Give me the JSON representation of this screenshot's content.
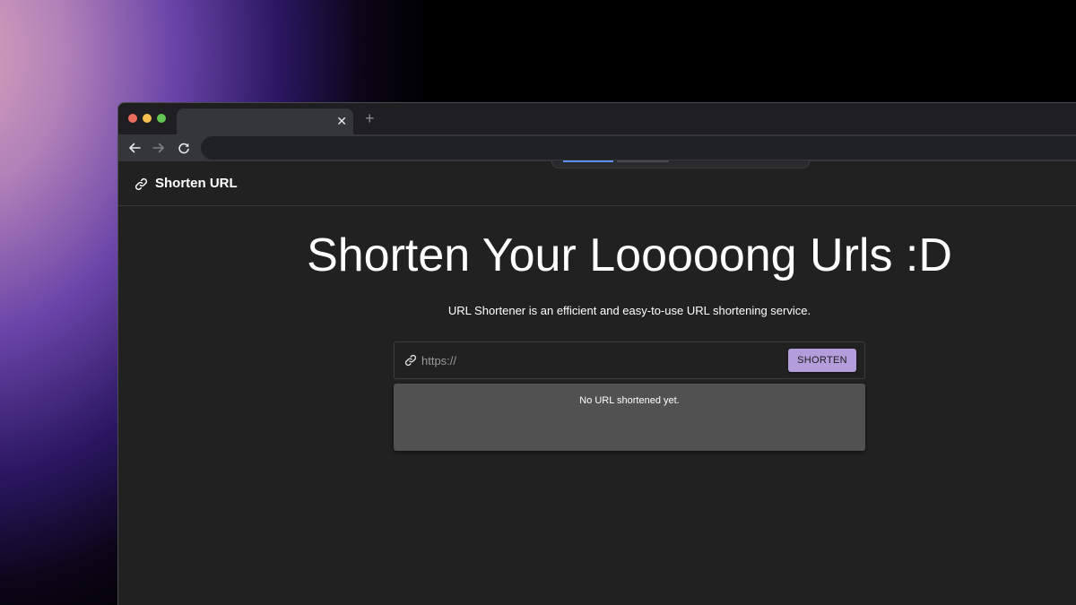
{
  "browser": {
    "tab_close": "✕",
    "new_tab": "+"
  },
  "header": {
    "brand_label": "Shorten URL"
  },
  "hero": {
    "title": "Shorten Your Looooong Urls :D",
    "subtitle": "URL Shortener is an efficient and easy-to-use URL shortening service."
  },
  "form": {
    "input_placeholder": "https://",
    "input_value": "",
    "button_label": "SHORTEN"
  },
  "result": {
    "message": "No URL shortened yet."
  },
  "colors": {
    "accent": "#b39ddb",
    "page_background": "#212121",
    "result_background": "#515151"
  }
}
